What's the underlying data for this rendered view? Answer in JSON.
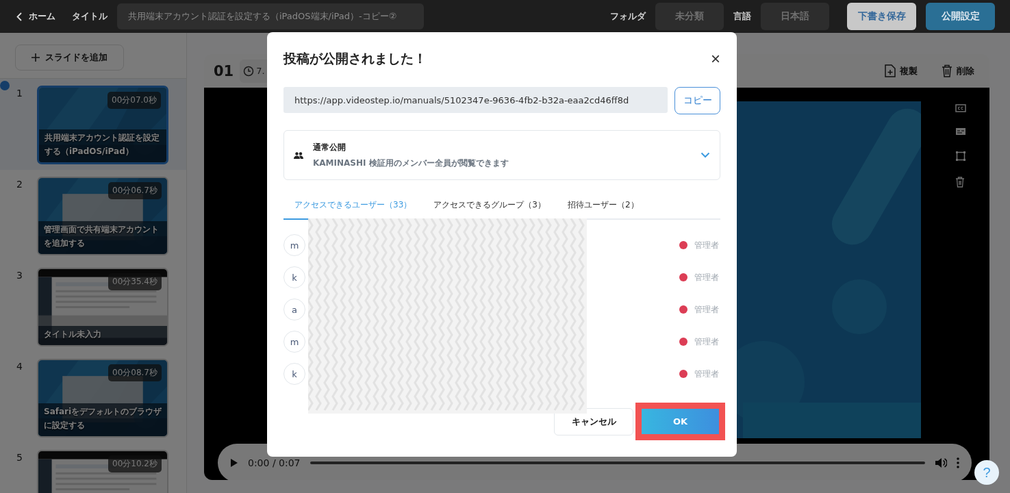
{
  "topbar": {
    "back": "ホーム",
    "title_label": "タイトル",
    "title_value": "共用端末アカウント認証を設定する（iPadOS端末/iPad）-コピー②",
    "folder_label": "フォルダ",
    "folder_value": "未分類",
    "language_label": "言語",
    "language_value": "日本語",
    "save_button": "下書き保存",
    "publish_button": "公開設定"
  },
  "sidebar": {
    "add_button": "スライドを追加",
    "slides": [
      {
        "number": "1",
        "duration": "00分07.0秒",
        "title": "共用端末アカウント認証を設定する（iPadOS/iPad）",
        "selected": true
      },
      {
        "number": "2",
        "duration": "00分06.7秒",
        "title": "管理画面で共有端末アカウントを追加する",
        "selected": false
      },
      {
        "number": "3",
        "duration": "00分35.4秒",
        "title": "タイトル未入力",
        "selected": false
      },
      {
        "number": "4",
        "duration": "00分08.7秒",
        "title": "Safariをデフォルトのブラウザに設定する",
        "selected": false
      },
      {
        "number": "5",
        "duration": "00分10.2秒",
        "selected": false
      }
    ]
  },
  "editor": {
    "slide_number": "01",
    "time_value": "7.",
    "duplicate": "複製",
    "delete": "削除",
    "player": {
      "time": "0:00 / 0:07"
    }
  },
  "help": "?",
  "dialog": {
    "title": "投稿が公開されました！",
    "close": "×",
    "url": "https://app.videostep.io/manuals/5102347e-9636-4fb2-b32a-eaa2cd46ff8d",
    "copy_button": "コピー",
    "visibility": {
      "title": "通常公開",
      "description": "KAMINASHI 検証用のメンバー全員が閲覧できます"
    },
    "tabs": [
      {
        "label": "アクセスできるユーザー（33）",
        "selected": true
      },
      {
        "label": "アクセスできるグループ（3）",
        "selected": false
      },
      {
        "label": "招待ユーザー（2）",
        "selected": false
      }
    ],
    "users": [
      {
        "avatar": "m",
        "role": "管理者",
        "color": "#dc3d55"
      },
      {
        "avatar": "k",
        "role": "管理者",
        "color": "#dc3d55"
      },
      {
        "avatar": "a",
        "role": "管理者",
        "color": "#dc3d55"
      },
      {
        "avatar": "m",
        "role": "管理者",
        "color": "#dc3d55"
      },
      {
        "avatar": "k",
        "role": "管理者",
        "color": "#dc3d55"
      }
    ],
    "cancel_button": "キャンセル",
    "ok_button": "OK"
  }
}
